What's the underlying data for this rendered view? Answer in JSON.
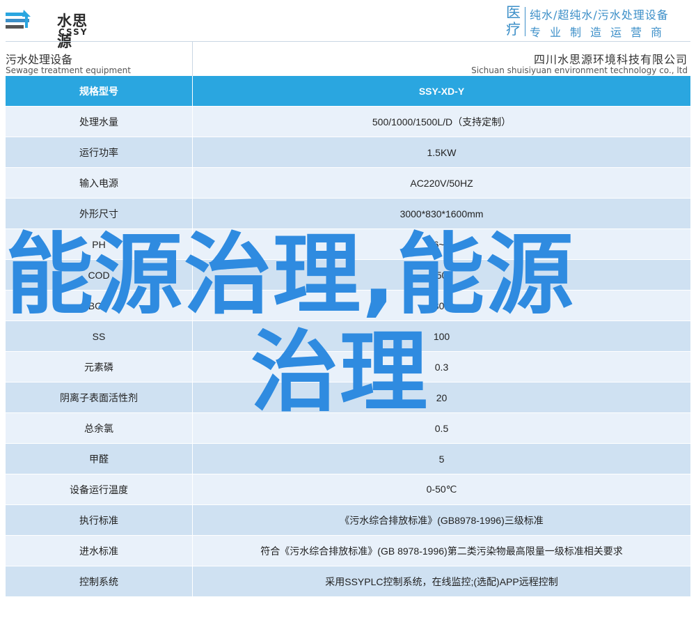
{
  "header": {
    "logo_cn": "水思源",
    "logo_en": "CSSY",
    "slogan_big": "医疗",
    "slogan_line1": "纯水/超纯水/污水处理设备",
    "slogan_line2": "专业制造运营商"
  },
  "titlebar": {
    "left_cn": "污水处理设备",
    "left_en": "Sewage treatment equipment",
    "right_cn": "四川水思源环境科技有限公司",
    "right_en": "Sichuan shuisiyuan environment technology co., ltd"
  },
  "table": {
    "header": {
      "key": "规格型号",
      "value": "SSY-XD-Y"
    },
    "rows": [
      {
        "key": "处理水量",
        "value": "500/1000/1500L/D（支持定制）"
      },
      {
        "key": "运行功率",
        "value": "1.5KW"
      },
      {
        "key": "输入电源",
        "value": "AC220V/50HZ"
      },
      {
        "key": "外形尺寸",
        "value": "3000*830*1600mm"
      },
      {
        "key": "PH",
        "value": "6~9"
      },
      {
        "key": "COD",
        "value": "50"
      },
      {
        "key": "BOD",
        "value": "300"
      },
      {
        "key": "SS",
        "value": "100"
      },
      {
        "key": "元素磷",
        "value": "0.3"
      },
      {
        "key": "阴离子表面活性剂",
        "value": "20"
      },
      {
        "key": "总余氯",
        "value": "0.5"
      },
      {
        "key": "甲醛",
        "value": "5"
      },
      {
        "key": "设备运行温度",
        "value": "0-50℃"
      },
      {
        "key": "执行标准",
        "value": "《污水综合排放标准》(GB8978-1996)三级标准"
      },
      {
        "key": "进水标准",
        "value": "符合《污水综合排放标准》(GB 8978-1996)第二类污染物最高限量一级标准相关要求"
      },
      {
        "key": "控制系统",
        "value": "采用SSYPLC控制系统，在线监控;(选配)APP远程控制"
      }
    ]
  },
  "overlay": {
    "line1": "能源治理,能源",
    "line2": "治理"
  },
  "colors": {
    "accent": "#2aa6e0",
    "row_light": "#e9f1fa",
    "row_dark": "#cfe1f2",
    "overlay": "#2f8be0"
  }
}
